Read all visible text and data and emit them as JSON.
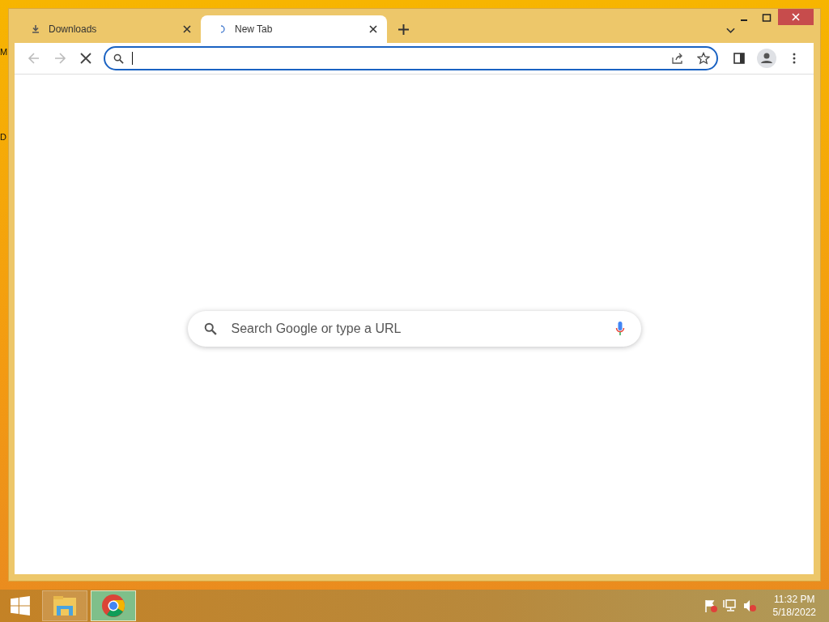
{
  "desktop_labels": [
    "M",
    "D"
  ],
  "tabs": [
    {
      "title": "Downloads",
      "kind": "download",
      "selected": false
    },
    {
      "title": "New Tab",
      "kind": "loading",
      "selected": true
    }
  ],
  "navigation": {
    "back_disabled": true,
    "forward_disabled": true
  },
  "search": {
    "placeholder": "Search Google or type a URL"
  },
  "taskbar": {
    "apps": [
      {
        "kind": "explorer",
        "selected": false
      },
      {
        "kind": "chrome",
        "selected": true
      }
    ],
    "time": "11:32 PM",
    "date": "5/18/2022"
  }
}
